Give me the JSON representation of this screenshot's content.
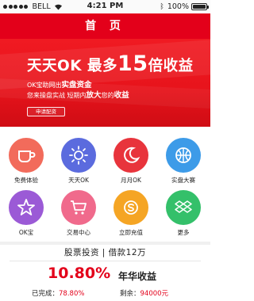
{
  "status_bar": {
    "carrier": "BELL",
    "time": "4:21 PM",
    "battery": "100%",
    "signal_icon": "signal-dots-icon",
    "wifi_icon": "wifi-icon",
    "bluetooth_icon": "bluetooth-icon",
    "battery_icon": "battery-icon"
  },
  "nav": {
    "title": "首 页"
  },
  "banner": {
    "title_prefix": "天天OK 最多",
    "title_number": "15",
    "title_suffix": "倍收益",
    "line1_prefix": "OK宝助网出",
    "line1_highlight": "实盘资金",
    "line2_prefix": "您来操盘实战 短期内",
    "line2_highlight": "放大",
    "line2_middle": "您的",
    "line2_highlight2": "收益",
    "apply_button": "申请配资"
  },
  "grid": {
    "items": [
      {
        "label": "免费体验",
        "icon": "coffee-cup-icon",
        "color": "#f26b5b"
      },
      {
        "label": "天天OK",
        "icon": "sun-icon",
        "color": "#5b6bde"
      },
      {
        "label": "月月OK",
        "icon": "crescent-moon-icon",
        "color": "#e8343c"
      },
      {
        "label": "实盘大赛",
        "icon": "basketball-icon",
        "color": "#3d9be8"
      },
      {
        "label": "OK宝",
        "icon": "star-icon",
        "color": "#9b5ad6"
      },
      {
        "label": "交易中心",
        "icon": "shopping-cart-icon",
        "color": "#f06a8c"
      },
      {
        "label": "立即充值",
        "icon": "skype-icon",
        "color": "#f5a524"
      },
      {
        "label": "更多",
        "icon": "dropbox-icon",
        "color": "#34c06a"
      }
    ]
  },
  "info": {
    "title": "股票投资 | 借款12万",
    "rate": "10.80%",
    "rate_label": "年华收益",
    "completed_label": "已完成：",
    "completed_value": "78.80%",
    "remaining_label": "剩余：",
    "remaining_value": "94000元"
  },
  "colors": {
    "brand_red": "#e3001a"
  }
}
